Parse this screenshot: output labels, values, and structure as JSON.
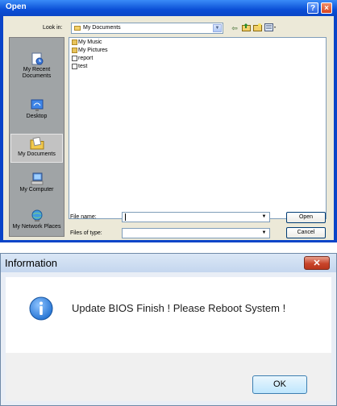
{
  "open_dialog": {
    "title": "Open",
    "help_glyph": "?",
    "close_glyph": "×",
    "look_in_label": "Look in:",
    "look_in_value": "My Documents",
    "places": [
      {
        "label": "My Recent Documents",
        "icon": "recent-documents-icon"
      },
      {
        "label": "Desktop",
        "icon": "desktop-icon"
      },
      {
        "label": "My Documents",
        "icon": "my-documents-icon",
        "selected": true
      },
      {
        "label": "My Computer",
        "icon": "my-computer-icon"
      },
      {
        "label": "My Network Places",
        "icon": "network-places-icon"
      }
    ],
    "files": [
      {
        "name": "My Music",
        "type": "folder"
      },
      {
        "name": "My Pictures",
        "type": "folder"
      },
      {
        "name": "report",
        "type": "document"
      },
      {
        "name": "test",
        "type": "document"
      }
    ],
    "file_name_label": "File name:",
    "file_name_value": "",
    "files_of_type_label": "Files of type:",
    "files_of_type_value": "",
    "open_button": "Open",
    "cancel_button": "Cancel"
  },
  "info_dialog": {
    "title": "Information",
    "close_glyph": "✕",
    "message": "Update BIOS Finish ! Please Reboot System !",
    "ok_button": "OK"
  },
  "colors": {
    "xp_title_blue": "#0b4fd6",
    "xp_dialog_face": "#ece9d8",
    "win7_close_red": "#c8442b",
    "info_icon_blue": "#1f6fd0"
  }
}
